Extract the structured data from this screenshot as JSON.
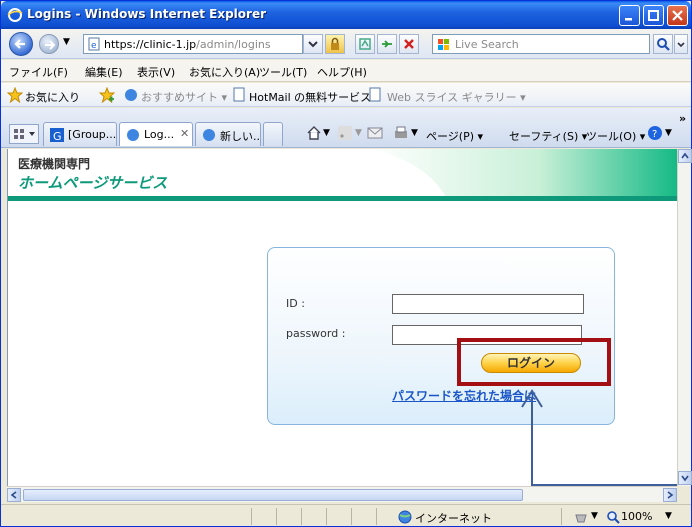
{
  "window": {
    "title": "Logins - Windows Internet Explorer"
  },
  "address": {
    "url_host": "https://clinic-1.jp",
    "url_path": "/admin/logins",
    "search_placeholder": "Live Search"
  },
  "menu": [
    "ファイル(F)",
    "編集(E)",
    "表示(V)",
    "お気に入り(A)",
    "ツール(T)",
    "ヘルプ(H)"
  ],
  "favorites": {
    "label": "お気に入り",
    "items": [
      "おすすめサイト ▾",
      "HotMail の無料サービス ▾",
      "Web スライス ギャラリー ▾"
    ]
  },
  "tabs": [
    {
      "label": "[Group..."
    },
    {
      "label": "Log..."
    },
    {
      "label": "新しい..."
    }
  ],
  "commands": {
    "page": "ページ(P) ▾",
    "safety": "セーフティ(S) ▾",
    "tools": "ツール(O) ▾"
  },
  "site": {
    "brand_small": "医療機関専門",
    "brand_large": "ホームページサービス"
  },
  "login": {
    "id_label": "ID :",
    "password_label": "password :",
    "id_value": "",
    "password_value": "",
    "submit_label": "ログイン",
    "forgot_label": "パスワードを忘れた場合は"
  },
  "status": {
    "zone": "インターネット",
    "zoom": "100%"
  },
  "colors": {
    "titlebar": "#0e4fd1",
    "brand_green": "#0e9a7a",
    "highlight": "#a30f12",
    "button_orange": "#ffd24a",
    "link_blue": "#1a56c9"
  }
}
